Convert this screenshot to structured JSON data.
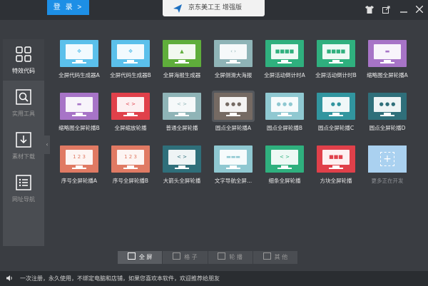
{
  "topbar": {
    "login_label": "登 录 >",
    "title": "京东美工王 增强版"
  },
  "window_controls": [
    "tshirt-icon",
    "share-icon",
    "minimize-icon",
    "close-icon"
  ],
  "sidebar": {
    "items": [
      {
        "label": "特效代码",
        "icon": "grid-icon",
        "active": true
      },
      {
        "label": "实用工具",
        "icon": "search-icon",
        "active": false
      },
      {
        "label": "素材下载",
        "icon": "download-icon",
        "active": false
      },
      {
        "label": "网址导航",
        "icon": "list-icon",
        "active": false
      }
    ]
  },
  "tiles": [
    {
      "label": "全屏代码生成器A",
      "color": "#5bc0eb",
      "glyph": "✥"
    },
    {
      "label": "全屏代码生成器B",
      "color": "#5bc0eb",
      "glyph": "✥"
    },
    {
      "label": "全屏海报生成器",
      "color": "#5fae3b",
      "glyph": "▲"
    },
    {
      "label": "全屏侧滑大海报",
      "color": "#8fb4b7",
      "glyph": "‹ ›"
    },
    {
      "label": "全屏活动倒计时A",
      "color": "#2fb07e",
      "glyph": "■■■■"
    },
    {
      "label": "全屏活动倒计时B",
      "color": "#2fb07e",
      "glyph": "■■■■"
    },
    {
      "label": "缩略图全屏轮播A",
      "color": "#a774c7",
      "glyph": "▬"
    },
    {
      "label": "缩略图全屏轮播B",
      "color": "#a774c7",
      "glyph": "▬"
    },
    {
      "label": "全屏缩放轮播",
      "color": "#e0404a",
      "glyph": "< >"
    },
    {
      "label": "普通全屏轮播",
      "color": "#8fb4b7",
      "glyph": "< >"
    },
    {
      "label": "圆点全屏轮播A",
      "color": "#756a63",
      "glyph": "● ● ●"
    },
    {
      "label": "圆点全屏轮播B",
      "color": "#8fc8d1",
      "glyph": "● ● ●"
    },
    {
      "label": "圆点全屏轮播C",
      "color": "#31959f",
      "glyph": "● ●"
    },
    {
      "label": "圆点全屏轮播D",
      "color": "#2f6f7a",
      "glyph": "● ● ●"
    },
    {
      "label": "序号全屏轮播A",
      "color": "#e07a63",
      "glyph": "1 2 3"
    },
    {
      "label": "序号全屏轮播B",
      "color": "#e07a63",
      "glyph": "1 2 3"
    },
    {
      "label": "大箭头全屏轮播",
      "color": "#2f6f7a",
      "glyph": "<   >"
    },
    {
      "label": "文字导航全屏...",
      "color": "#8fc8d1",
      "glyph": "▬▬▬"
    },
    {
      "label": "细条全屏轮播",
      "color": "#2fb07e",
      "glyph": "<  >"
    },
    {
      "label": "方块全屏轮播",
      "color": "#e0404a",
      "glyph": "■■■"
    },
    {
      "label": "更多正在开发",
      "color": "#aad1f0",
      "glyph": "+",
      "placeholder": true
    }
  ],
  "bottom_tabs": [
    {
      "label": "全 屏",
      "active": true
    },
    {
      "label": "格 子",
      "active": false
    },
    {
      "label": "轮 播",
      "active": false
    },
    {
      "label": "其 他",
      "active": false
    }
  ],
  "statusbar": {
    "message": "一次注册，永久使用，不绑定电脑和店铺，如果您喜欢本软件，欢迎推荐给朋友"
  }
}
